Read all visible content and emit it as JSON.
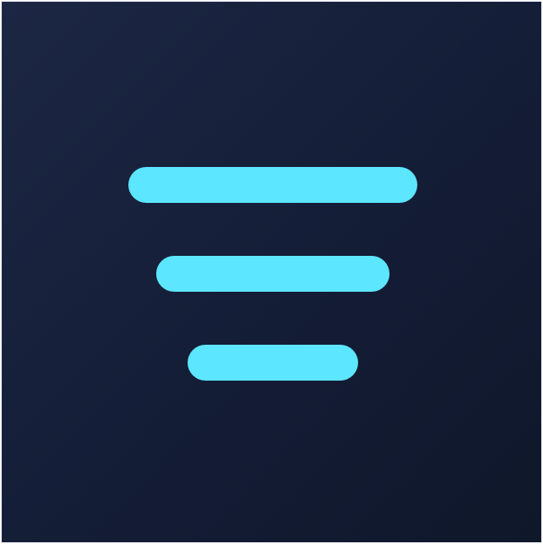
{
  "icon": {
    "name": "filter-icon",
    "bar_color": "#5ce6ff",
    "background_colors": [
      "#1c2744",
      "#141d36",
      "#0f172a"
    ]
  }
}
